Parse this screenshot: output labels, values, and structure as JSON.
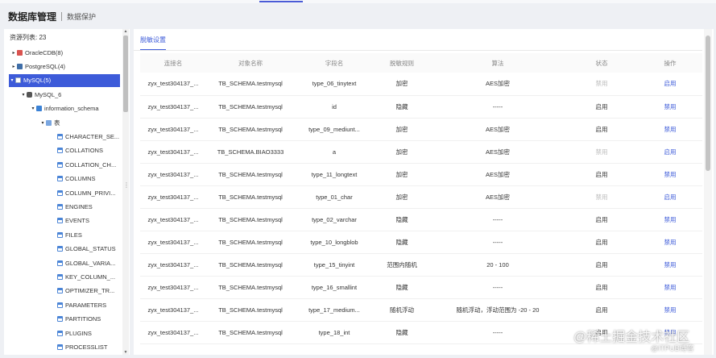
{
  "header": {
    "title": "数据库管理",
    "subtitle": "数据保护"
  },
  "left": {
    "count_label": "资源列表: 23",
    "tree": [
      {
        "label": "OracleCDB(8)",
        "icon": "oracle-icon",
        "caret": "▸",
        "level": 0
      },
      {
        "label": "PostgreSQL(4)",
        "icon": "postgresql-icon",
        "caret": "▸",
        "level": 0
      },
      {
        "label": "MySQL(5)",
        "icon": "mysql-icon",
        "caret": "▾",
        "level": 0,
        "selected": true
      },
      {
        "label": "MySQL_6",
        "icon": "database-icon",
        "caret": "▾",
        "level": 1
      },
      {
        "label": "information_schema",
        "icon": "schema-icon",
        "caret": "▾",
        "level": 2
      },
      {
        "label": "表",
        "icon": "folder-icon",
        "caret": "▾",
        "level": 3
      },
      {
        "label": "CHARACTER_SE...",
        "icon": "table-icon",
        "caret": "",
        "level": 4
      },
      {
        "label": "COLLATIONS",
        "icon": "table-icon",
        "caret": "",
        "level": 4
      },
      {
        "label": "COLLATION_CH...",
        "icon": "table-icon",
        "caret": "",
        "level": 4
      },
      {
        "label": "COLUMNS",
        "icon": "table-icon",
        "caret": "",
        "level": 4
      },
      {
        "label": "COLUMN_PRIVI...",
        "icon": "table-icon",
        "caret": "",
        "level": 4
      },
      {
        "label": "ENGINES",
        "icon": "table-icon",
        "caret": "",
        "level": 4
      },
      {
        "label": "EVENTS",
        "icon": "table-icon",
        "caret": "",
        "level": 4
      },
      {
        "label": "FILES",
        "icon": "table-icon",
        "caret": "",
        "level": 4
      },
      {
        "label": "GLOBAL_STATUS",
        "icon": "table-icon",
        "caret": "",
        "level": 4
      },
      {
        "label": "GLOBAL_VARIA...",
        "icon": "table-icon",
        "caret": "",
        "level": 4
      },
      {
        "label": "KEY_COLUMN_...",
        "icon": "table-icon",
        "caret": "",
        "level": 4
      },
      {
        "label": "OPTIMIZER_TR...",
        "icon": "table-icon",
        "caret": "",
        "level": 4
      },
      {
        "label": "PARAMETERS",
        "icon": "table-icon",
        "caret": "",
        "level": 4
      },
      {
        "label": "PARTITIONS",
        "icon": "table-icon",
        "caret": "",
        "level": 4
      },
      {
        "label": "PLUGINS",
        "icon": "table-icon",
        "caret": "",
        "level": 4
      },
      {
        "label": "PROCESSLIST",
        "icon": "table-icon",
        "caret": "",
        "level": 4
      }
    ]
  },
  "main": {
    "tab_label": "脱敏设置",
    "columns": [
      "连接名",
      "对象名称",
      "字段名",
      "脱敏规则",
      "算法",
      "状态",
      "操作"
    ],
    "rows": [
      {
        "conn": "zyx_test304137_...",
        "obj": "TB_SCHEMA.testmysql",
        "field": "type_06_tinytext",
        "rule": "加密",
        "algo": "AES加密",
        "status": "禁用",
        "status_disabled": true,
        "op": "启用"
      },
      {
        "conn": "zyx_test304137_...",
        "obj": "TB_SCHEMA.testmysql",
        "field": "id",
        "rule": "隐藏",
        "algo": "-----",
        "status": "启用",
        "status_disabled": false,
        "op": "禁用"
      },
      {
        "conn": "zyx_test304137_...",
        "obj": "TB_SCHEMA.testmysql",
        "field": "type_09_mediunt...",
        "rule": "加密",
        "algo": "AES加密",
        "status": "启用",
        "status_disabled": false,
        "op": "禁用"
      },
      {
        "conn": "zyx_test304137_...",
        "obj": "TB_SCHEMA.BIAO3333",
        "field": "a",
        "rule": "加密",
        "algo": "AES加密",
        "status": "禁用",
        "status_disabled": true,
        "op": "启用"
      },
      {
        "conn": "zyx_test304137_...",
        "obj": "TB_SCHEMA.testmysql",
        "field": "type_11_longtext",
        "rule": "加密",
        "algo": "AES加密",
        "status": "启用",
        "status_disabled": false,
        "op": "禁用"
      },
      {
        "conn": "zyx_test304137_...",
        "obj": "TB_SCHEMA.testmysql",
        "field": "type_01_char",
        "rule": "加密",
        "algo": "AES加密",
        "status": "禁用",
        "status_disabled": true,
        "op": "启用"
      },
      {
        "conn": "zyx_test304137_...",
        "obj": "TB_SCHEMA.testmysql",
        "field": "type_02_varchar",
        "rule": "隐藏",
        "algo": "-----",
        "status": "启用",
        "status_disabled": false,
        "op": "禁用"
      },
      {
        "conn": "zyx_test304137_...",
        "obj": "TB_SCHEMA.testmysql",
        "field": "type_10_longblob",
        "rule": "隐藏",
        "algo": "-----",
        "status": "启用",
        "status_disabled": false,
        "op": "禁用"
      },
      {
        "conn": "zyx_test304137_...",
        "obj": "TB_SCHEMA.testmysql",
        "field": "type_15_tinyint",
        "rule": "范围内随机",
        "algo": "20 - 100",
        "status": "启用",
        "status_disabled": false,
        "op": "禁用"
      },
      {
        "conn": "zyx_test304137_...",
        "obj": "TB_SCHEMA.testmysql",
        "field": "type_16_smallint",
        "rule": "隐藏",
        "algo": "-----",
        "status": "启用",
        "status_disabled": false,
        "op": "禁用"
      },
      {
        "conn": "zyx_test304137_...",
        "obj": "TB_SCHEMA.testmysql",
        "field": "type_17_medium...",
        "rule": "随机浮动",
        "algo": "随机浮动，浮动范围为 -20 - 20",
        "status": "启用",
        "status_disabled": false,
        "op": "禁用"
      },
      {
        "conn": "zyx_test304137_...",
        "obj": "TB_SCHEMA.testmysql",
        "field": "type_18_int",
        "rule": "隐藏",
        "algo": "-----",
        "status": "启用",
        "status_disabled": false,
        "op": "禁用"
      }
    ]
  },
  "watermark": {
    "line1": "@稀土掘金技术社区",
    "line2": "@ITPUB博客"
  },
  "colors": {
    "accent": "#3d5bd9",
    "disabled_text": "#bbbbbb"
  }
}
